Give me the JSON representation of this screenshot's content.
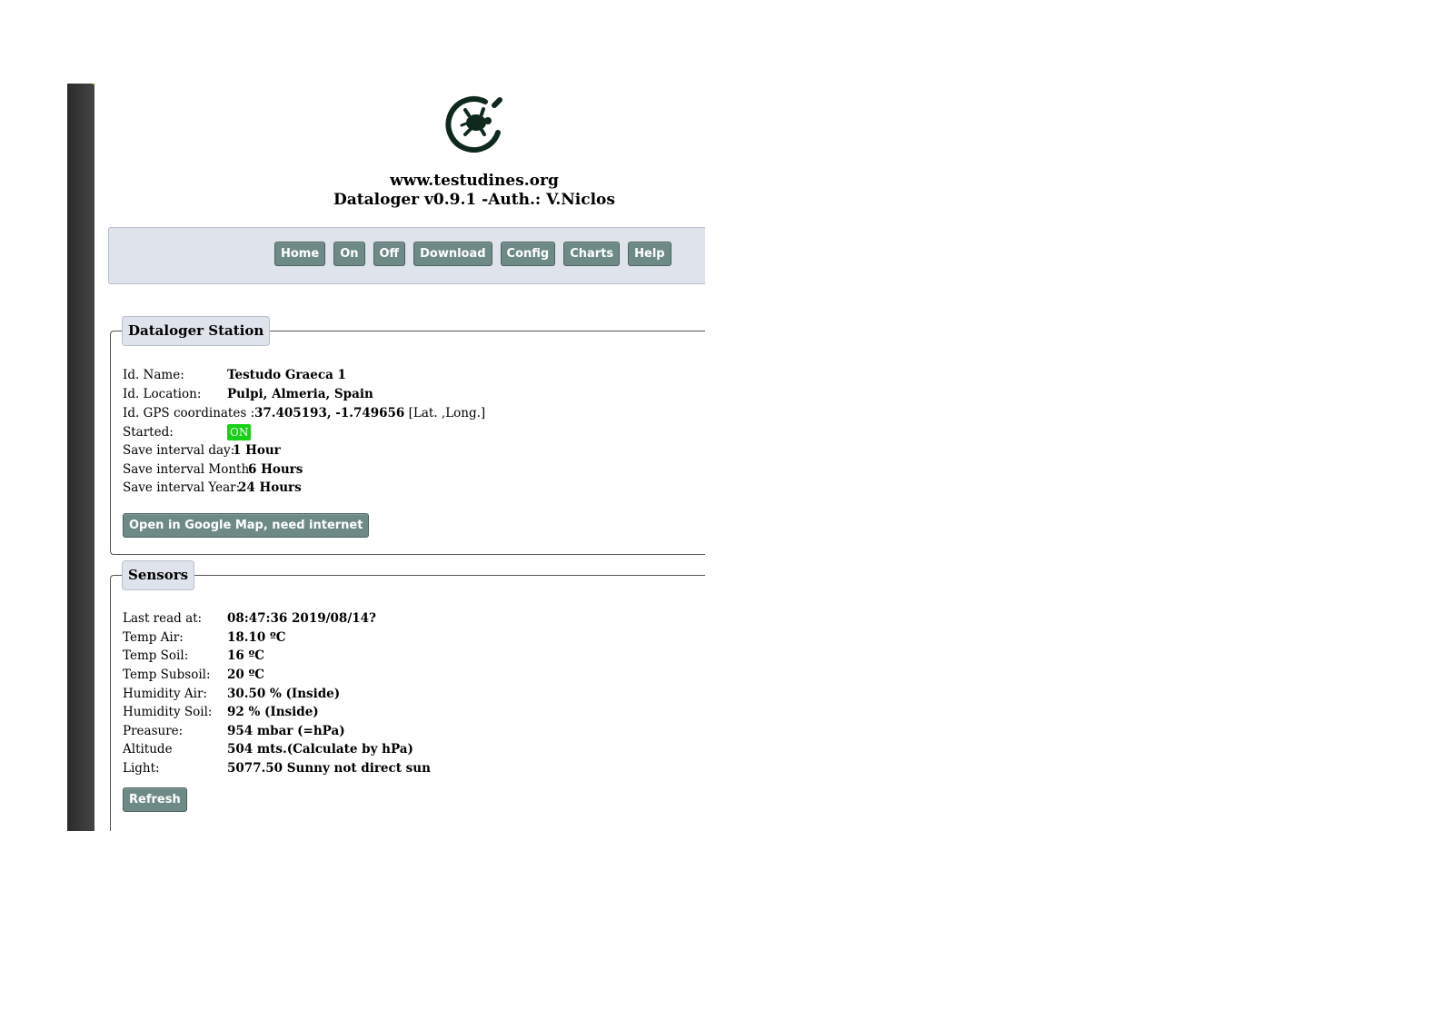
{
  "header": {
    "logo_icon": "turtle-logo-icon",
    "site_url": "www.testudines.org",
    "app_title": "Dataloger v0.9.1 -Auth.: V.Niclos"
  },
  "nav": {
    "home": "Home",
    "on": "On",
    "off": "Off",
    "download": "Download",
    "config": "Config",
    "charts": "Charts",
    "help": "Help"
  },
  "station": {
    "legend": "Dataloger Station",
    "id_name_label": "Id. Name:",
    "id_name_value": "Testudo Graeca 1",
    "id_location_label": "Id. Location:",
    "id_location_value": "Pulpi, Almeria, Spain",
    "gps_label": "Id. GPS coordinates :",
    "gps_value": "37.405193, -1.749656",
    "gps_suffix": "[Lat. ,Long.]",
    "started_label": "Started:",
    "started_badge": "ON",
    "day_label": "Save interval day:",
    "day_value": "1 Hour",
    "month_label": "Save interval Month:",
    "month_value": "6 Hours",
    "year_label": "Save interval Year:",
    "year_value": "24 Hours",
    "map_button": "Open in Google Map, need internet"
  },
  "sensors": {
    "legend": "Sensors",
    "last_read_label": "Last read at:",
    "last_read_value": "08:47:36 2019/08/14?",
    "temp_air_label": "Temp Air:",
    "temp_air_value": "18.10 ºC",
    "temp_soil_label": "Temp Soil:",
    "temp_soil_value": "16 ºC",
    "temp_subsoil_label": "Temp Subsoil:",
    "temp_subsoil_value": "20 ºC",
    "hum_air_label": "Humidity Air:",
    "hum_air_value": "30.50 % (Inside)",
    "hum_soil_label": "Humidity Soil:",
    "hum_soil_value": "92 % (Inside)",
    "pressure_label": "Preasure:",
    "pressure_value": "954 mbar (=hPa)",
    "altitude_label": "Altitude",
    "altitude_value": "504 mts.(Calculate by hPa)",
    "light_label": "Light:",
    "light_value": "5077.50 Sunny not direct sun",
    "refresh_button": "Refresh"
  },
  "colors": {
    "button": "#6e8a86",
    "panel": "#dfe3ec",
    "badge_on": "#17d117",
    "sidebar": "#333333"
  }
}
